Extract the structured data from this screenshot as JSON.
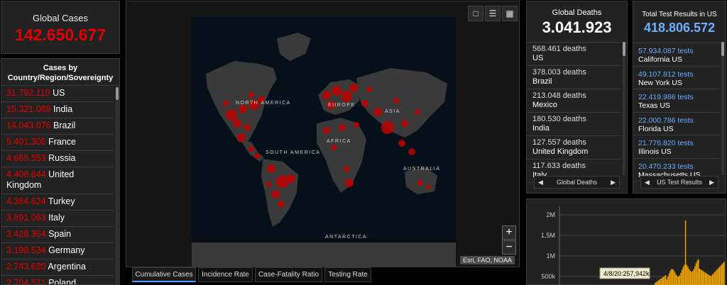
{
  "global_cases": {
    "title": "Global Cases",
    "value": "142.650.677"
  },
  "cases_list": {
    "header": "Cases by Country/Region/Sovereignty",
    "rows": [
      {
        "num": "31.792.110",
        "country": "US"
      },
      {
        "num": "15.321.089",
        "country": "India"
      },
      {
        "num": "14.043.076",
        "country": "Brazil"
      },
      {
        "num": "5.401.305",
        "country": "France"
      },
      {
        "num": "4.665.553",
        "country": "Russia"
      },
      {
        "num": "4.408.644",
        "country": "United Kingdom"
      },
      {
        "num": "4.384.624",
        "country": "Turkey"
      },
      {
        "num": "3.891.063",
        "country": "Italy"
      },
      {
        "num": "3.428.354",
        "country": "Spain"
      },
      {
        "num": "3.198.534",
        "country": "Germany"
      },
      {
        "num": "2.743.620",
        "country": "Argentina"
      },
      {
        "num": "2.704.571",
        "country": "Poland"
      }
    ]
  },
  "map": {
    "labels": {
      "na": "NORTH AMERICA",
      "sa": "SOUTH AMERICA",
      "eu": "EUROPE",
      "asia": "ASIA",
      "africa": "AFRICA",
      "aus": "AUSTRALIA",
      "ant": "ANTARCTICA"
    },
    "attribution": "Esri, FAO, NOAA",
    "zoom_in": "+",
    "zoom_out": "−",
    "colors": {
      "ocean": "#06101a",
      "land": "#3a3a3a",
      "marker": "#c00000"
    }
  },
  "tabs": [
    "Cumulative Cases",
    "Incidence Rate",
    "Case-Fatality Ratio",
    "Testing Rate"
  ],
  "global_deaths": {
    "title": "Global Deaths",
    "value": "3.041.923",
    "rows": [
      {
        "num": "568.461 deaths",
        "country": "US"
      },
      {
        "num": "378.003 deaths",
        "country": "Brazil"
      },
      {
        "num": "213.048 deaths",
        "country": "Mexico"
      },
      {
        "num": "180.530 deaths",
        "country": "India"
      },
      {
        "num": "127.557 deaths",
        "country": "United Kingdom"
      },
      {
        "num": "117.633 deaths",
        "country": "Italy"
      }
    ],
    "pager_label": "Global Deaths"
  },
  "test_results": {
    "title": "Total Test Results in US",
    "value": "418.806.572",
    "rows": [
      {
        "num": "57.934.087 tests",
        "state": "California US"
      },
      {
        "num": "49.107.812 tests",
        "state": "New York US"
      },
      {
        "num": "22.419.986 tests",
        "state": "Texas US"
      },
      {
        "num": "22.000.786 tests",
        "state": "Florida US"
      },
      {
        "num": "21.776.820 tests",
        "state": "Illinois US"
      },
      {
        "num": "20.470.233 tests",
        "state": "Massachusetts US"
      }
    ],
    "pager_label": "US Test Results"
  },
  "chart_data": {
    "type": "bar",
    "ylabels": [
      "2M",
      "1,5M",
      "1M",
      "500k"
    ],
    "tooltip": "4/8/20:257,942k",
    "color": "#f5a800"
  }
}
